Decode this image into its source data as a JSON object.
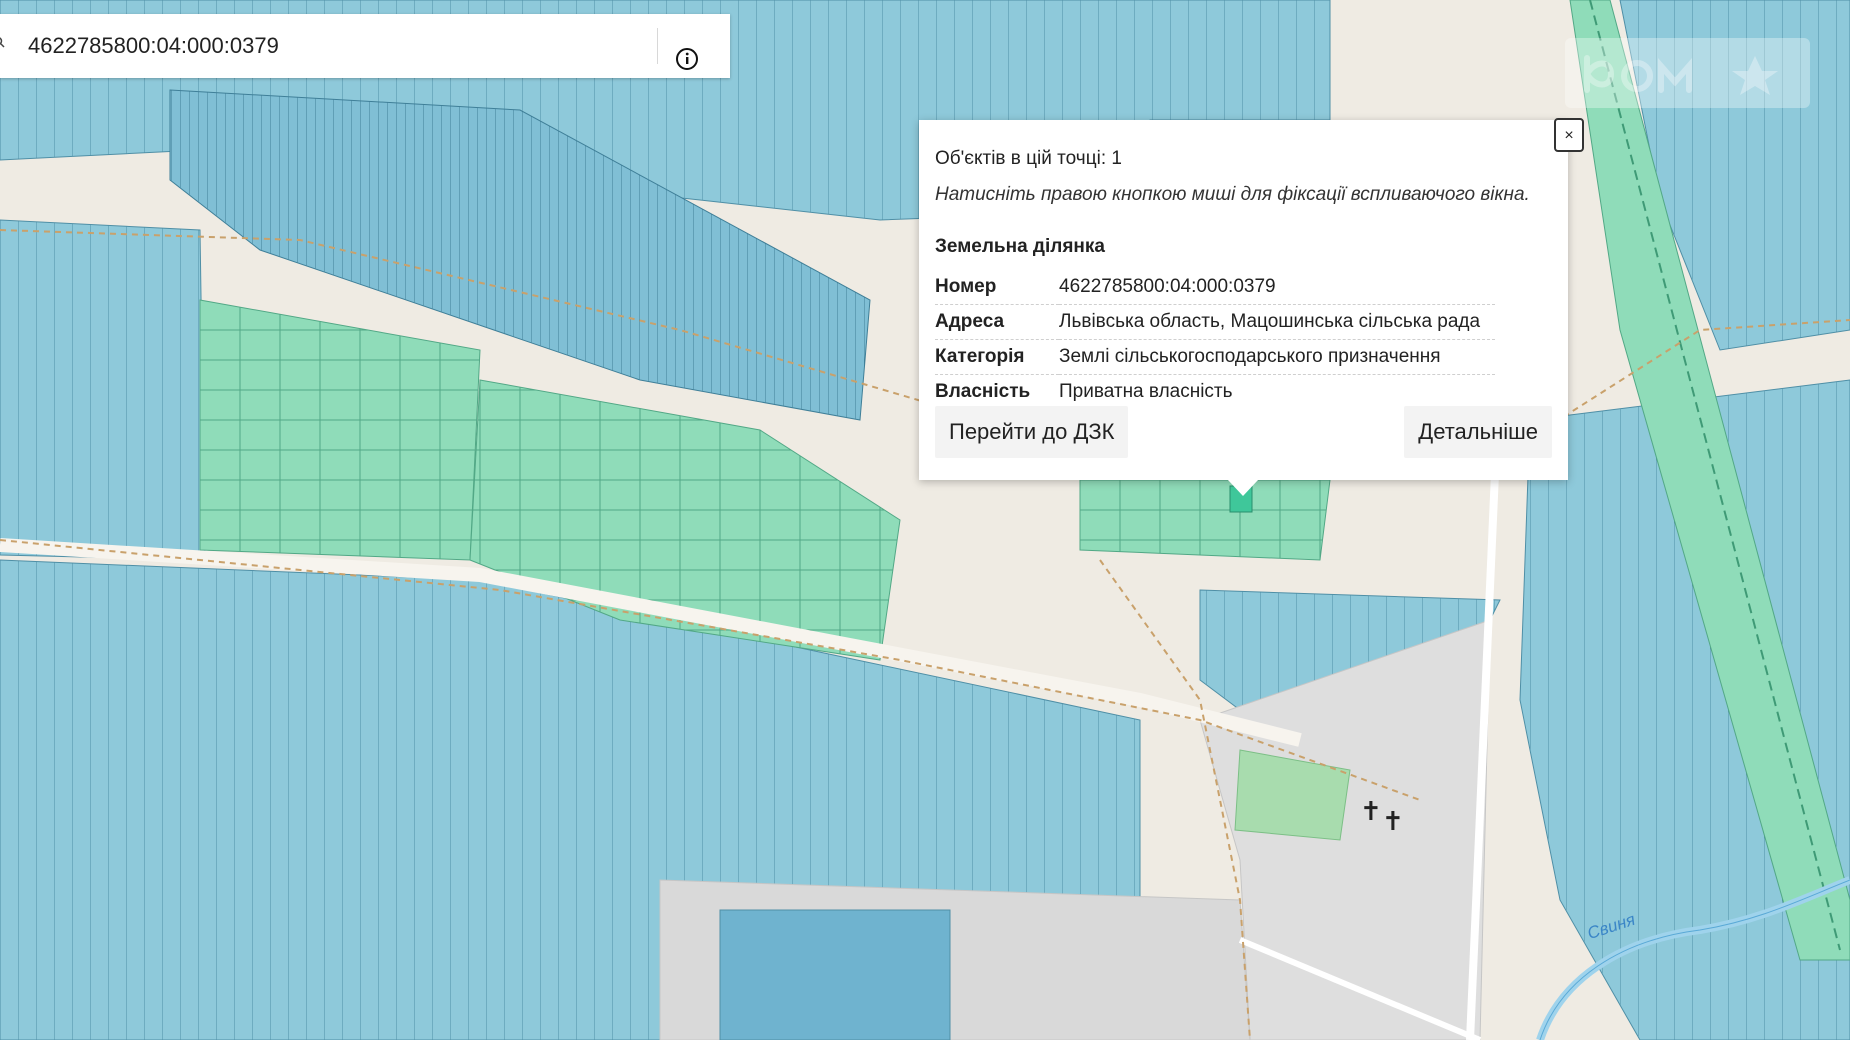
{
  "search": {
    "value": "4622785800:04:000:0379"
  },
  "popup": {
    "close_label": "×",
    "count_text": "Об'єктів в цій точці: 1",
    "hint_text": "Натисніть правою кнопкою миші для фіксації вспливаючого вікна.",
    "section_title": "Земельна ділянка",
    "attributes": [
      {
        "key": "Номер",
        "value": "4622785800:04:000:0379"
      },
      {
        "key": "Адреса",
        "value": "Львівська область, Мацошинська сільська рада"
      },
      {
        "key": "Категорія",
        "value": "Землі сільськогосподарського призначення"
      },
      {
        "key": "Власність",
        "value": "Приватна власність"
      }
    ],
    "btn_dzk": "Перейти до ДЗК",
    "btn_details": "Детальніше"
  },
  "map": {
    "river_label": "Свиня",
    "colors": {
      "background": "#efebe3",
      "parcel_blue": "#8ec9da",
      "parcel_blue_dark": "#6fb3cf",
      "parcel_green": "#8fdcb9",
      "parcel_border": "#4f8fa6",
      "road_dashed": "#c9a16b",
      "highlight": "#3fc79a",
      "river": "#9fd3ec"
    }
  }
}
